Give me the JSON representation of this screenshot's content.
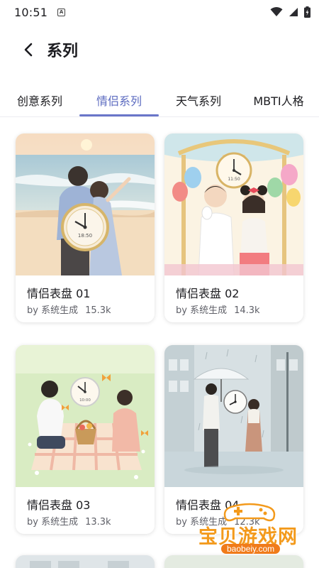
{
  "status_bar": {
    "time": "10:51",
    "notification_letter": "A"
  },
  "header": {
    "title": "系列"
  },
  "tabs": [
    {
      "label": "创意系列",
      "active": false
    },
    {
      "label": "情侣系列",
      "active": true
    },
    {
      "label": "天气系列",
      "active": false
    },
    {
      "label": "MBTI人格",
      "active": false
    }
  ],
  "cards": [
    {
      "title": "情侣表盘 01",
      "author": "by 系统生成",
      "count": "15.3k",
      "clock_text": "18:50"
    },
    {
      "title": "情侣表盘 02",
      "author": "by 系统生成",
      "count": "14.3k",
      "clock_text": "11:50"
    },
    {
      "title": "情侣表盘 03",
      "author": "by 系统生成",
      "count": "13.3k",
      "clock_text": "10:00"
    },
    {
      "title": "情侣表盘 04",
      "author": "by 系统生成",
      "count": "12.3k"
    }
  ],
  "watermark": {
    "text": "宝贝游戏网",
    "url": "baobeiy.com"
  },
  "colors": {
    "accent": "#5c6bc0",
    "watermark": "#f39a1c"
  }
}
